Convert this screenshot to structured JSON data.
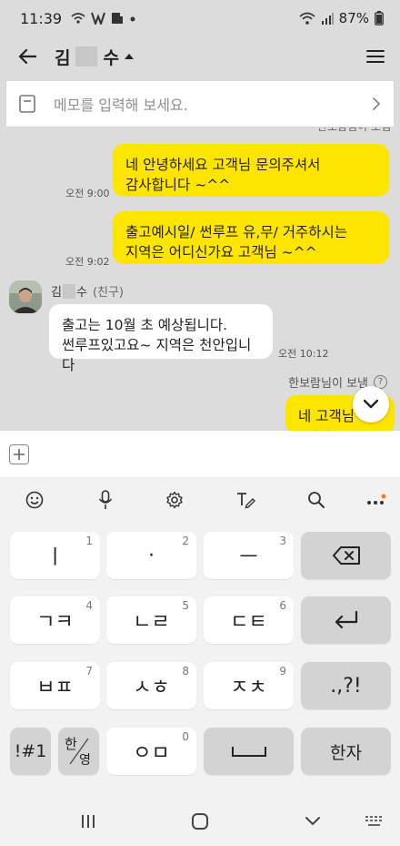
{
  "status_bar": {
    "time": "11:39",
    "battery": "87%"
  },
  "header": {
    "name_first": "김",
    "name_last": "수"
  },
  "memo": {
    "placeholder": "메모를 입력해 보세요."
  },
  "chat": {
    "partial_top": "한보람님이 보냄",
    "messages": [
      {
        "side": "right",
        "lines": [
          "네 안녕하세요 고객님 문의주셔서",
          "감사합니다 ~^^"
        ],
        "time": "오전 9:00"
      },
      {
        "side": "right",
        "lines": [
          "출고예시일/ 썬루프 유,무/ 거주하시는",
          "지역은 어디신가요 고객님 ~^^"
        ],
        "time": "오전 9:02"
      },
      {
        "side": "left",
        "lines": [
          "출고는 10월 초 예상됩니다.",
          "썬루프있고요~ 지역은 천안입니다"
        ],
        "time": "오전 10:12"
      },
      {
        "side": "right",
        "lines": [
          "네 고객님 ~^^"
        ],
        "time": ""
      }
    ],
    "sender": {
      "name_first": "김",
      "name_last": "수",
      "tag": "(친구)"
    },
    "sent_by": "한보람님이 보냄",
    "qmark": "?"
  },
  "keyboard": {
    "rows": [
      [
        {
          "label": "ㅣ",
          "hint": "1"
        },
        {
          "label": "·",
          "hint": "2"
        },
        {
          "label": "ㅡ",
          "hint": "3"
        },
        {
          "label": "backspace",
          "hint": ""
        }
      ],
      [
        {
          "label": "ㄱㅋ",
          "hint": "4"
        },
        {
          "label": "ㄴㄹ",
          "hint": "5"
        },
        {
          "label": "ㄷㅌ",
          "hint": "6"
        },
        {
          "label": "enter",
          "hint": ""
        }
      ],
      [
        {
          "label": "ㅂㅍ",
          "hint": "7"
        },
        {
          "label": "ㅅㅎ",
          "hint": "8"
        },
        {
          "label": "ㅈㅊ",
          "hint": "9"
        },
        {
          "label": ".,?!",
          "hint": ""
        }
      ],
      [
        {
          "label": "!#1",
          "hint": ""
        },
        {
          "label": "한/영",
          "hint": ""
        },
        {
          "label": "ㅇㅁ",
          "hint": "0"
        },
        {
          "label": "space",
          "hint": ""
        },
        {
          "label": "한자",
          "hint": ""
        }
      ]
    ],
    "lang_top": "한",
    "lang_bottom": "영"
  },
  "icons": [
    "back-arrow-icon",
    "menu-icon",
    "memo-icon",
    "chevron-right-icon",
    "emoji-icon",
    "mic-icon",
    "settings-icon",
    "handwriting-icon",
    "search-icon",
    "more-icon",
    "chevron-down-icon",
    "plus-icon",
    "recent-apps-icon",
    "home-icon",
    "nav-back-icon",
    "keyboard-icon"
  ],
  "colors": {
    "accent_yellow": "#fee500",
    "chat_bg": "#dcdcdc",
    "orange_dot": "#f07a1c"
  }
}
